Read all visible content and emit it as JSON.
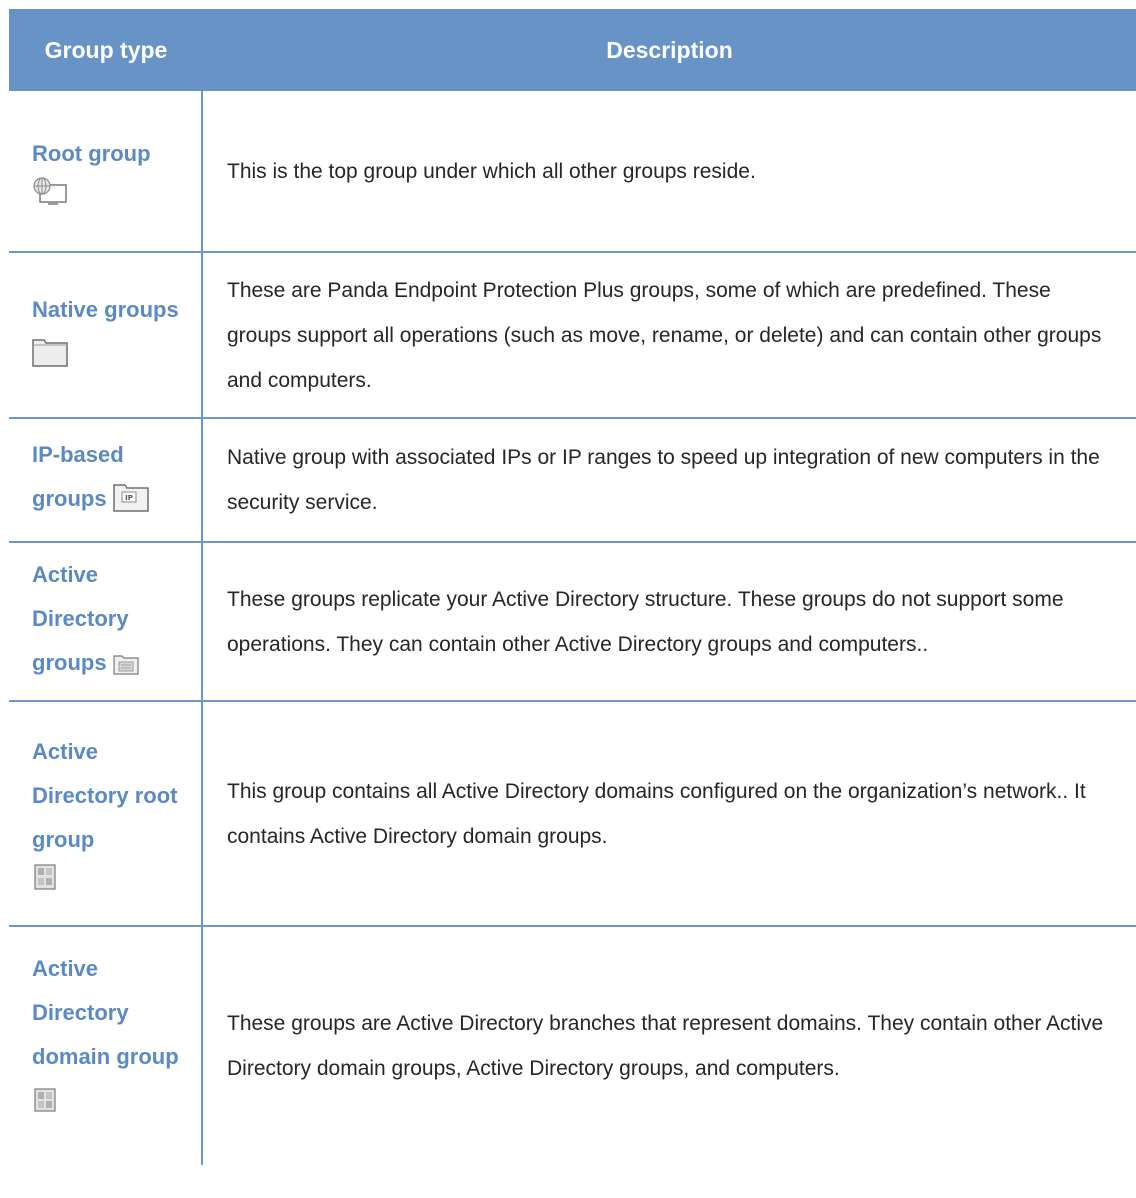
{
  "header": {
    "col1": "Group type",
    "col2": "Description"
  },
  "rows": [
    {
      "name": "Root group",
      "icon": "root-group-icon",
      "description": "This is the top group under which all other groups reside."
    },
    {
      "name": "Native groups",
      "icon": "folder-icon",
      "description": "These are Panda Endpoint Protection Plus groups, some of which are predefined. These groups support all operations (such as move, rename, or delete) and can contain other groups and computers."
    },
    {
      "name": "IP-based groups",
      "icon": "ip-folder-icon",
      "description": "Native group with associated IPs or IP ranges to speed up integration of new computers in the security service."
    },
    {
      "name": "Active Directory groups",
      "icon": "ad-group-icon",
      "description": "These groups replicate your Active Directory structure. These groups do not support some operations. They can contain other Active Directory groups and computers.."
    },
    {
      "name": "Active Directory root group",
      "icon": "ad-root-icon",
      "description": "This group contains all Active Directory domains configured on the organization’s network.. It contains Active Directory domain groups."
    },
    {
      "name": "Active Directory domain group",
      "icon": "ad-domain-icon",
      "description": "These groups are Active Directory branches that represent domains. They contain other Active Directory domain groups, Active Directory groups, and computers."
    }
  ]
}
